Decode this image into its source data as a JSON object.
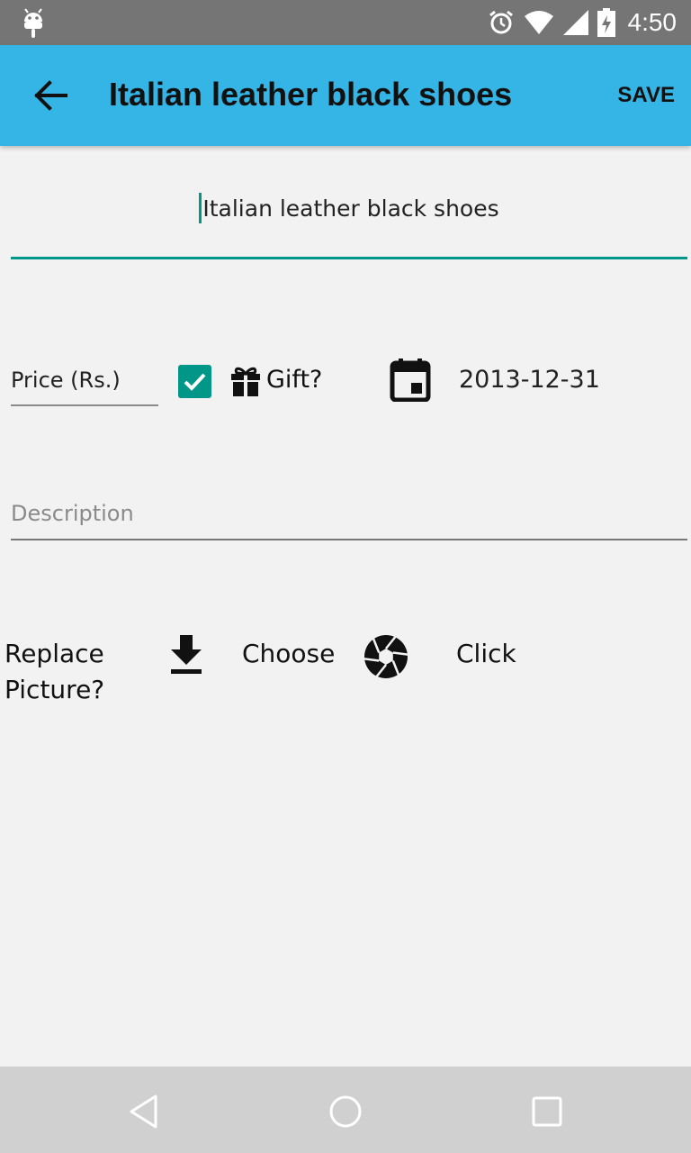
{
  "status_bar": {
    "time": "4:50",
    "icons": [
      "android-icon",
      "alarm-icon",
      "wifi-icon",
      "signal-icon",
      "battery-charging-icon"
    ]
  },
  "app_bar": {
    "title": "Italian leather black shoes",
    "save_label": "SAVE",
    "background_color": "#35b5e5",
    "back_icon": "arrow-back-icon"
  },
  "form": {
    "item_name_value": "Italian leather black shoes",
    "price_value": "Price (Rs.)",
    "gift_checked": true,
    "gift_label": "Gift?",
    "date_value": "2013-12-31",
    "description_placeholder": "Description",
    "description_value": "",
    "accent_color": "#009688"
  },
  "picture": {
    "replace_label": "Replace Picture?",
    "choose_label": "Choose",
    "click_label": "Click",
    "choose_icon": "download-icon",
    "click_icon": "camera-aperture-icon"
  },
  "nav_bar": {
    "icons": [
      "back-triangle-icon",
      "home-circle-icon",
      "recents-square-icon"
    ]
  }
}
